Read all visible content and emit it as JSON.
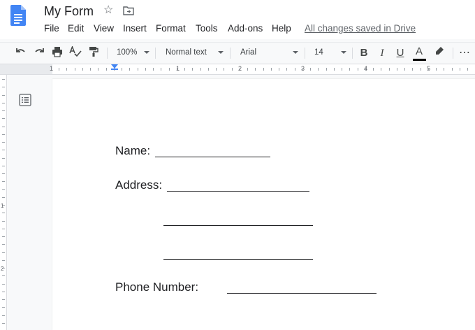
{
  "header": {
    "title": "My Form",
    "menu": [
      "File",
      "Edit",
      "View",
      "Insert",
      "Format",
      "Tools",
      "Add-ons",
      "Help"
    ],
    "save_status": "All changes saved in Drive"
  },
  "toolbar": {
    "zoom": "100%",
    "style": "Normal text",
    "font": "Arial",
    "font_size": "14",
    "bold": "B",
    "italic": "I",
    "underline": "U",
    "text_color": "A",
    "more": "⋯"
  },
  "ruler": {
    "numbers": [
      "1",
      "1",
      "2",
      "3",
      "4",
      "5"
    ]
  },
  "vruler": {
    "numbers": [
      "1",
      "2"
    ]
  },
  "document": {
    "name_label": "Name:",
    "address_label": "Address:",
    "phone_label": "Phone Number:"
  },
  "colors": {
    "accent": "#4285f4",
    "text": "#202124",
    "icons": "#444746"
  }
}
